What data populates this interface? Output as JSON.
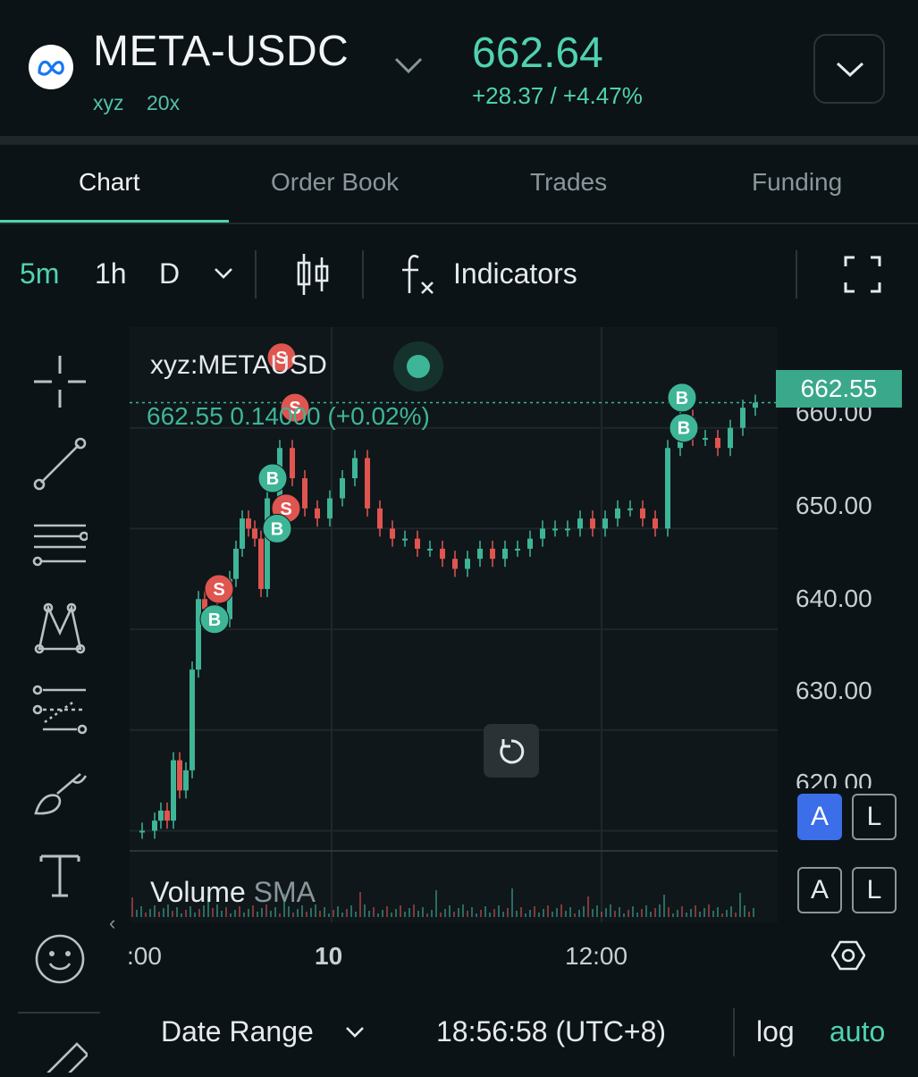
{
  "header": {
    "symbol": "META-USDC",
    "dex": "xyz",
    "leverage": "20x",
    "last_price": "662.64",
    "change": "+28.37 / +4.47%",
    "logo_icon": "meta-logo-icon",
    "menu_icon": "chevron-down-icon"
  },
  "tabs": [
    {
      "label": "Chart",
      "active": true
    },
    {
      "label": "Order Book",
      "active": false
    },
    {
      "label": "Trades",
      "active": false
    },
    {
      "label": "Funding",
      "active": false
    }
  ],
  "toolbar": {
    "intervals": [
      "5m",
      "1h",
      "D"
    ],
    "selected_interval": "5m",
    "indicators_label": "Indicators",
    "candle_icon": "candlestick-icon",
    "fx_icon": "fx-icon",
    "fullscreen_icon": "fullscreen-icon"
  },
  "chart": {
    "legend_symbol": "xyz:METAUSD",
    "legend_values": "662.55  0.14000 (+0.02%)",
    "current_price_tag": "662.55",
    "volume_label": "Volume",
    "volume_sma": "SMA",
    "scale_buttons_top": [
      "A",
      "L"
    ],
    "scale_buttons_bottom": [
      "A",
      "L"
    ]
  },
  "chart_data": {
    "type": "line",
    "y_ticks": [
      "660.00",
      "650.00",
      "640.00",
      "630.00",
      "620.00"
    ],
    "x_ticks": [
      ":00",
      "10",
      "12:00"
    ],
    "ylim": [
      618,
      670
    ],
    "x": [
      0,
      2,
      4,
      5,
      6,
      7,
      8,
      9,
      10,
      11,
      12,
      14,
      16,
      17,
      18,
      19,
      20,
      21,
      22,
      24,
      26,
      28,
      30,
      32,
      34,
      36,
      38,
      40,
      42,
      44,
      46,
      48,
      50,
      52,
      54,
      56,
      58,
      60,
      62,
      64,
      66,
      68,
      70,
      72,
      74,
      76,
      78,
      80,
      82,
      84,
      86,
      88,
      90,
      92,
      94,
      96,
      98,
      100
    ],
    "series": [
      {
        "values": [
          620,
          620,
          621,
          622,
          621,
          627,
          624,
          626,
          636,
          643,
          642,
          641,
          645,
          648,
          651,
          650,
          649,
          644,
          653,
          658,
          655,
          652,
          651,
          653,
          655,
          657,
          652,
          650,
          649,
          649,
          648,
          648,
          647,
          646,
          647,
          648,
          647,
          648,
          648,
          649,
          650,
          650,
          650,
          651,
          650,
          651,
          652,
          652,
          651,
          650,
          658,
          661,
          659,
          659,
          658,
          660,
          662,
          662.5
        ]
      }
    ],
    "trade_markers": [
      {
        "side": "B",
        "price": 663
      },
      {
        "side": "B",
        "price": 660
      },
      {
        "side": "S",
        "price": 667
      },
      {
        "side": "S",
        "price": 662
      },
      {
        "side": "B",
        "price": 655
      },
      {
        "side": "S",
        "price": 652
      },
      {
        "side": "B",
        "price": 650
      },
      {
        "side": "S",
        "price": 644
      },
      {
        "side": "B",
        "price": 641
      }
    ],
    "colors": {
      "up": "#3fb597",
      "down": "#e0554f",
      "grid": "#1e272b"
    }
  },
  "left_tools": [
    "crosshair-icon",
    "trend-line-icon",
    "horizontal-lines-icon",
    "pattern-icon",
    "fib-icon",
    "brush-icon",
    "text-icon",
    "emoji-icon",
    "ruler-icon"
  ],
  "bottom": {
    "date_range": "Date Range",
    "time": "18:56:58 (UTC+8)",
    "log": "log",
    "auto": "auto",
    "settings_icon": "settings-icon"
  }
}
